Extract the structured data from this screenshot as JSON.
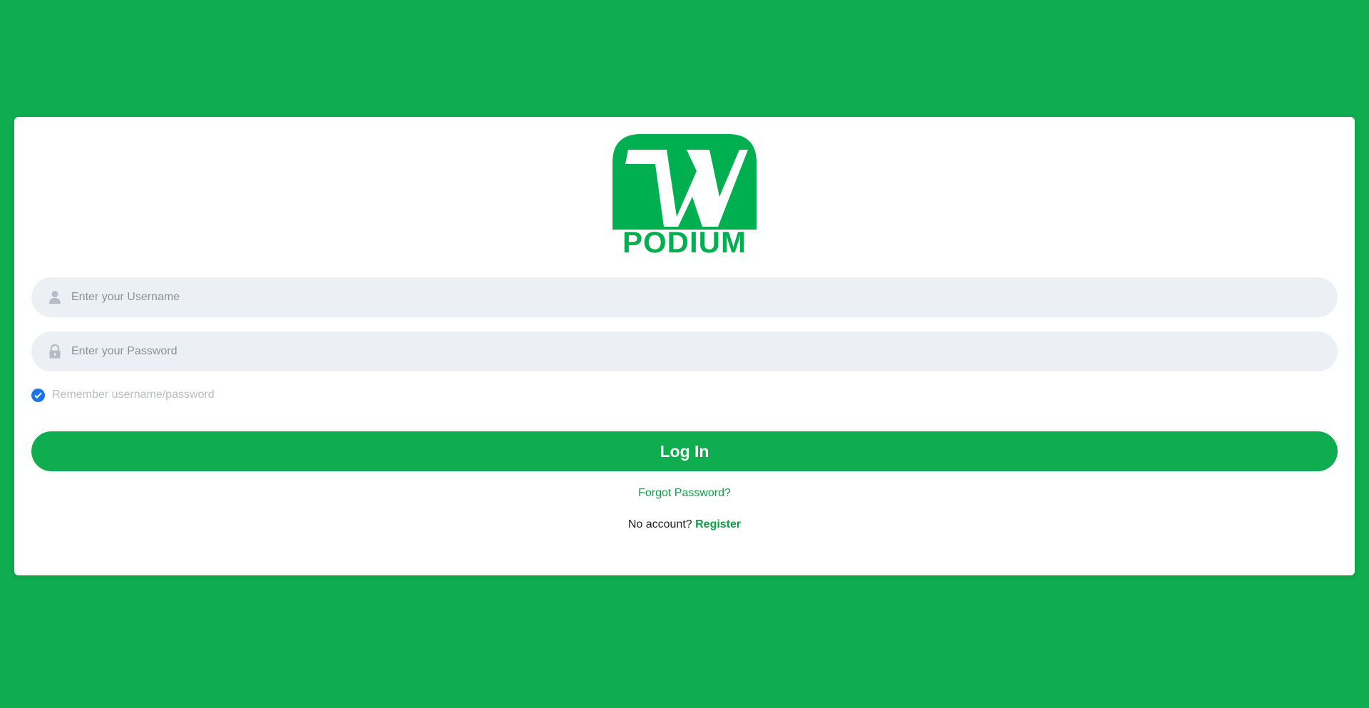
{
  "brand": {
    "logo_text": "PODIUM",
    "color": "#0fad4f"
  },
  "login_form": {
    "username_placeholder": "Enter your Username",
    "username_icon": "user-icon",
    "password_placeholder": "Enter your Password",
    "password_icon": "lock-icon",
    "remember_label": "Remember username/password",
    "remember_checked": true,
    "login_button_label": "Log In",
    "forgot_password_label": "Forgot Password?",
    "no_account_text": "No account?",
    "register_label": "Register"
  }
}
